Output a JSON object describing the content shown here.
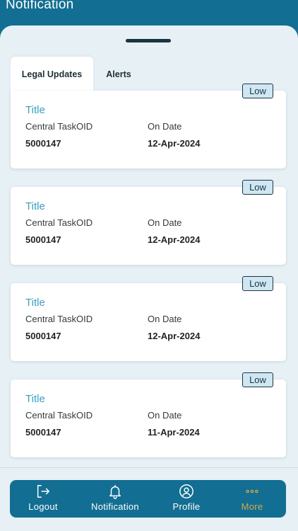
{
  "header": {
    "title": "Notification"
  },
  "tabs": [
    {
      "label": "Legal Updates",
      "active": true
    },
    {
      "label": "Alerts",
      "active": false
    }
  ],
  "cards": [
    {
      "badge": "Low",
      "title": "Title",
      "id_label": "Central TaskOID",
      "date_label": "On Date",
      "id_value": "5000147",
      "date_value": "12-Apr-2024"
    },
    {
      "badge": "Low",
      "title": "Title",
      "id_label": "Central TaskOID",
      "date_label": "On Date",
      "id_value": "5000147",
      "date_value": "12-Apr-2024"
    },
    {
      "badge": "Low",
      "title": "Title",
      "id_label": "Central TaskOID",
      "date_label": "On Date",
      "id_value": "5000147",
      "date_value": "12-Apr-2024"
    },
    {
      "badge": "Low",
      "title": "Title",
      "id_label": "Central TaskOID",
      "date_label": "On Date",
      "id_value": "5000147",
      "date_value": "11-Apr-2024"
    }
  ],
  "bottom_nav": [
    {
      "label": "Logout",
      "icon": "logout-icon"
    },
    {
      "label": "Notification",
      "icon": "bell-icon"
    },
    {
      "label": "Profile",
      "icon": "user-icon"
    },
    {
      "label": "More",
      "icon": "more-dots-icon",
      "active": true
    }
  ],
  "colors": {
    "primary": "#126e92",
    "background": "#e6f0f5",
    "title_accent": "#3b9ec2",
    "badge_fill": "#cfe7f2",
    "more_active": "#d3a94a"
  }
}
